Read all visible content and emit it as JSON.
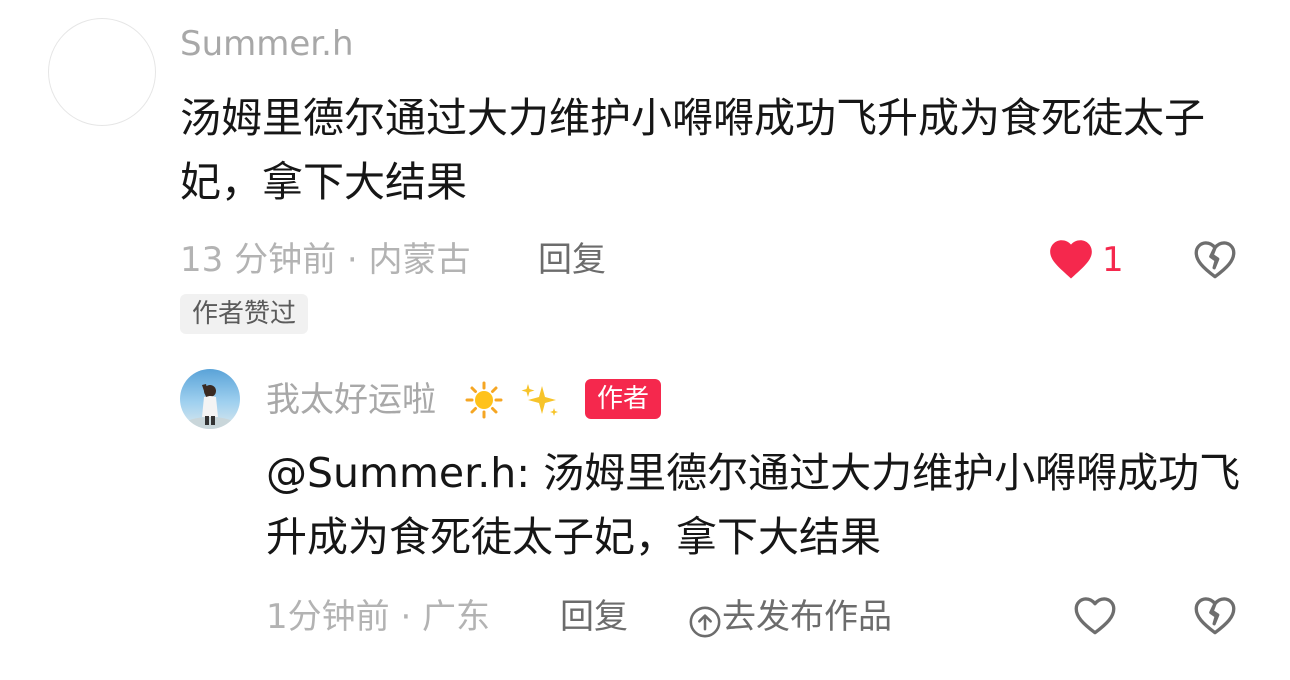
{
  "comment": {
    "username": "Summer.h",
    "content": "汤姆里德尔通过大力维护小嘚嘚成功飞升成为食死徒太子妃，拿下大结果",
    "time_location": "13 分钟前 · 内蒙古",
    "reply_label": "回复",
    "like_count": "1",
    "tag": "作者赞过",
    "colors": {
      "like_active": "#f5284d",
      "muted_text": "#b3b3b3"
    }
  },
  "reply": {
    "username": "我太好运啦",
    "emojis": [
      "sun-emoji",
      "sparkles-emoji"
    ],
    "author_badge": "作者",
    "mention": "@Summer.h:",
    "content": "汤姆里德尔通过大力维护小嘚嘚成功飞升成为食死徒太子妃，拿下大结果",
    "time_location": "1分钟前 · 广东",
    "reply_label": "回复",
    "publish_label": "去发布作品",
    "colors": {
      "badge": "#f5284d"
    }
  }
}
